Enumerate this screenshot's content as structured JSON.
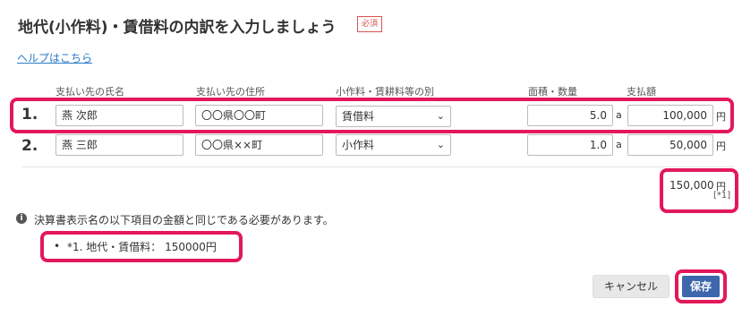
{
  "header": {
    "title": "地代(小作料)・賃借料の内訳を入力しましょう",
    "required_badge": "必須"
  },
  "help_link": "ヘルプはこちら",
  "columns": {
    "payee_name": "支払い先の氏名",
    "payee_address": "支払い先の住所",
    "category": "小作料・賃耕料等の別",
    "area_qty": "面積・数量",
    "amount": "支払額"
  },
  "rows": [
    {
      "num": "1.",
      "name": "燕 次郎",
      "address": "〇〇県〇〇町",
      "category": "賃借料",
      "area": "5.0",
      "area_unit": "a",
      "amount": "100,000",
      "amount_unit": "円"
    },
    {
      "num": "2.",
      "name": "燕 三郎",
      "address": "〇〇県××町",
      "category": "小作料",
      "area": "1.0",
      "area_unit": "a",
      "amount": "50,000",
      "amount_unit": "円"
    }
  ],
  "total": {
    "value": "150,000",
    "unit": "円",
    "ref": "[*1]"
  },
  "note": {
    "icon": "info-icon",
    "text": "決算書表示名の以下項目の金額と同じである必要があります。",
    "bullet": "•",
    "item": "*1. 地代・賃借料： 150000円"
  },
  "buttons": {
    "cancel": "キャンセル",
    "save": "保存"
  },
  "colors": {
    "highlight": "#e3185a",
    "save_button": "#3d66ad",
    "link": "#2a7ac7",
    "badge": "#d9534f"
  }
}
